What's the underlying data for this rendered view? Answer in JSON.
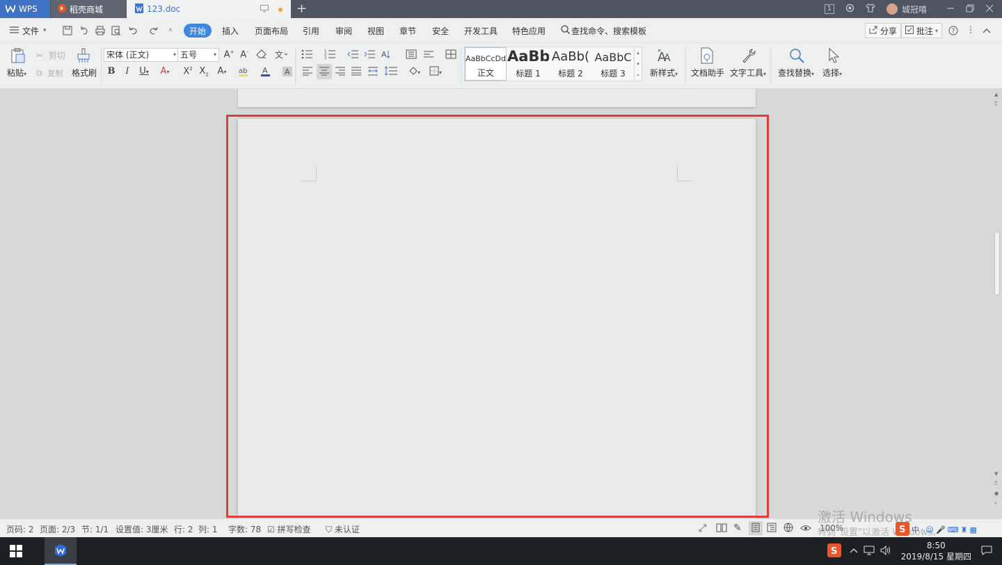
{
  "titlebar": {
    "tab_wps": "WPS",
    "tab_shop": "稻壳商城",
    "tab_doc": "123.doc",
    "page_indicator": "1",
    "username": "城冠嘻"
  },
  "menubar": {
    "file": "文件",
    "items": [
      "开始",
      "插入",
      "页面布局",
      "引用",
      "审阅",
      "视图",
      "章节",
      "安全",
      "开发工具",
      "特色应用"
    ],
    "search": "查找命令、搜索模板",
    "share": "分享",
    "comment": "批注"
  },
  "ribbon": {
    "paste": "粘贴",
    "cut": "剪切",
    "copy": "复制",
    "format_painter": "格式刷",
    "font_name": "宋体 (正文)",
    "font_size": "五号",
    "styles": [
      {
        "preview": "AaBbCcDd",
        "label": "正文"
      },
      {
        "preview": "AaBb",
        "label": "标题 1"
      },
      {
        "preview": "AaBb(",
        "label": "标题 2"
      },
      {
        "preview": "AaBbC",
        "label": "标题 3"
      }
    ],
    "new_style": "新样式",
    "doc_assistant": "文档助手",
    "text_tools": "文字工具",
    "find_replace": "查找替换",
    "select": "选择"
  },
  "status": {
    "page_no": "页码: 2",
    "pages": "页面: 2/3",
    "section": "节: 1/1",
    "setting": "设置值: 3厘米",
    "row": "行: 2",
    "col": "列: 1",
    "words": "字数: 78",
    "spell": "拼写检查",
    "cert": "未认证",
    "zoom": "100%"
  },
  "watermark": {
    "line1": "激活 Windows",
    "line2": "转到\"设置\"以激活 Windows。"
  },
  "taskbar": {
    "time": "8:50",
    "date": "2019/8/15 星期四",
    "ime": "中"
  },
  "colors": {
    "accent": "#3f85e4",
    "highlight": "#e23c3c",
    "wps_tab": "#3d72c4"
  }
}
